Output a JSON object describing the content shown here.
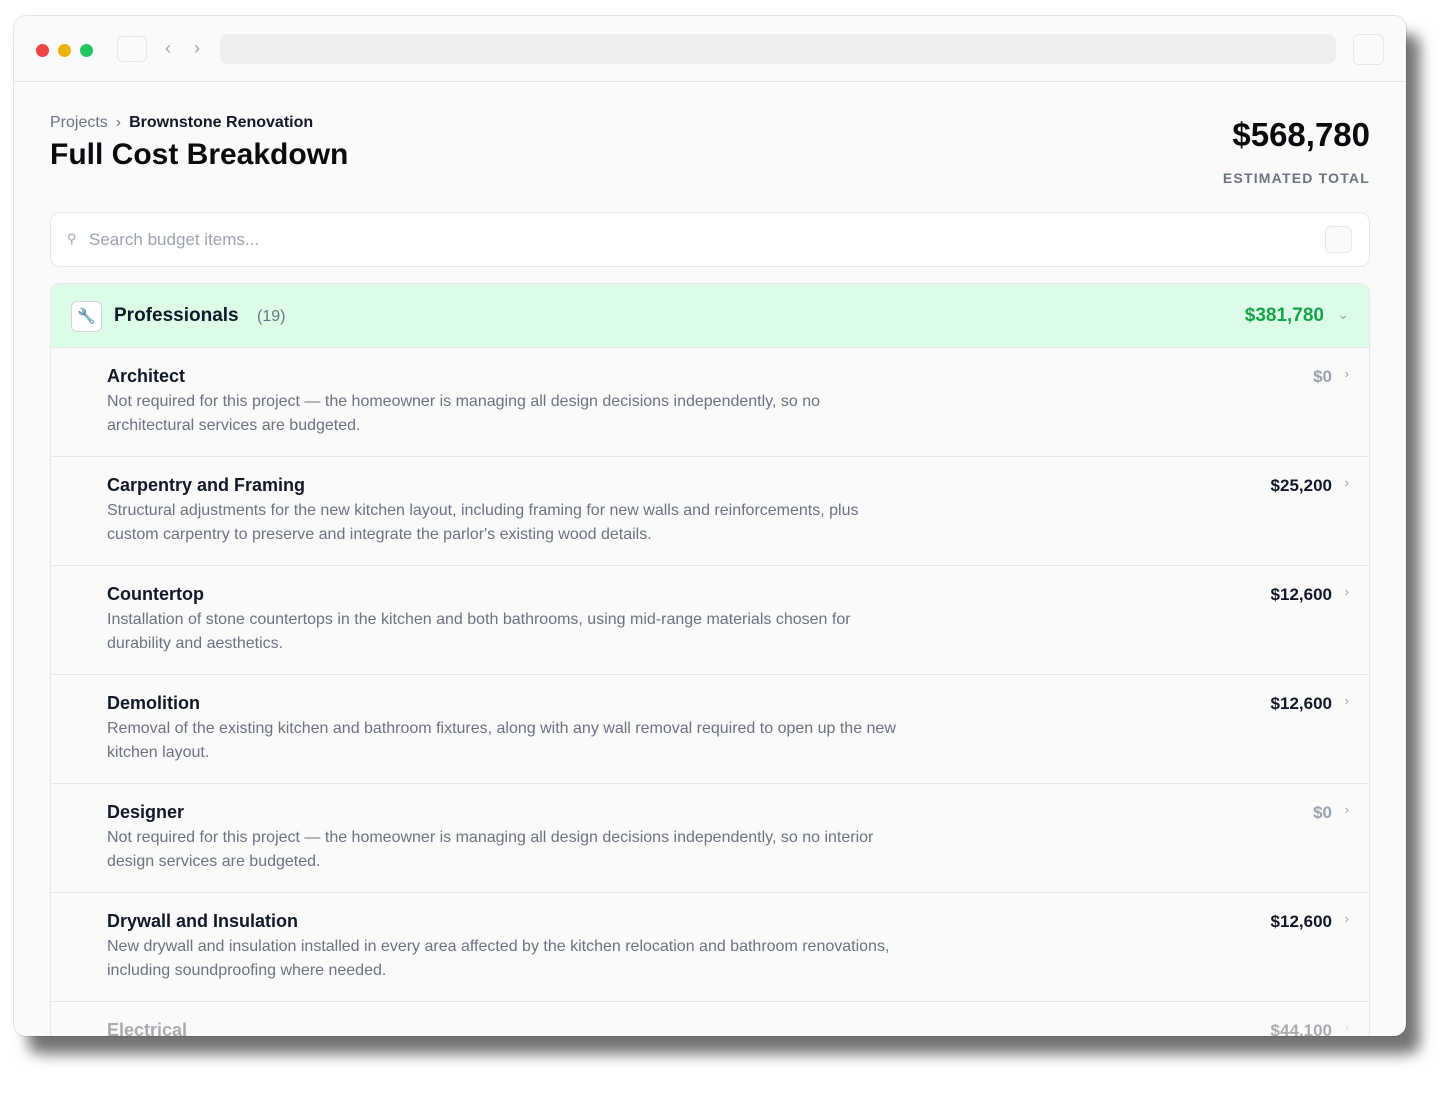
{
  "browser": {
    "back_icon": "‹",
    "forward_icon": "›"
  },
  "breadcrumb": {
    "parent": "Projects",
    "separator": "›",
    "current": "Brownstone Renovation"
  },
  "page": {
    "title": "Full Cost Breakdown",
    "total_amount": "$568,780",
    "total_label": "ESTIMATED TOTAL"
  },
  "search": {
    "placeholder": "Search budget items...",
    "value": ""
  },
  "category": {
    "name": "Professionals",
    "count": "(19)",
    "total": "$381,780",
    "icon": "wrench-icon",
    "accent_color": "#16a34a",
    "header_bg": "#dcfce7"
  },
  "items": [
    {
      "name": "Architect",
      "description": "Not required for this project — the homeowner is managing all design decisions independently, so no architectural services are budgeted.",
      "cost": "$0"
    },
    {
      "name": "Carpentry and Framing",
      "description": "Structural adjustments for the new kitchen layout, including framing for new walls and reinforcements, plus custom carpentry to preserve and integrate the parlor's existing wood details.",
      "cost": "$25,200"
    },
    {
      "name": "Countertop",
      "description": "Installation of stone countertops in the kitchen and both bathrooms, using mid-range materials chosen for durability and aesthetics.",
      "cost": "$12,600"
    },
    {
      "name": "Demolition",
      "description": "Removal of the existing kitchen and bathroom fixtures, along with any wall removal required to open up the new kitchen layout.",
      "cost": "$12,600"
    },
    {
      "name": "Designer",
      "description": "Not required for this project — the homeowner is managing all design decisions independently, so no interior design services are budgeted.",
      "cost": "$0"
    },
    {
      "name": "Drywall and Insulation",
      "description": "New drywall and insulation installed in every area affected by the kitchen relocation and bathroom renovations, including soundproofing where needed.",
      "cost": "$12,600"
    },
    {
      "name": "Electrical",
      "description": "",
      "cost": "$44,100"
    }
  ]
}
